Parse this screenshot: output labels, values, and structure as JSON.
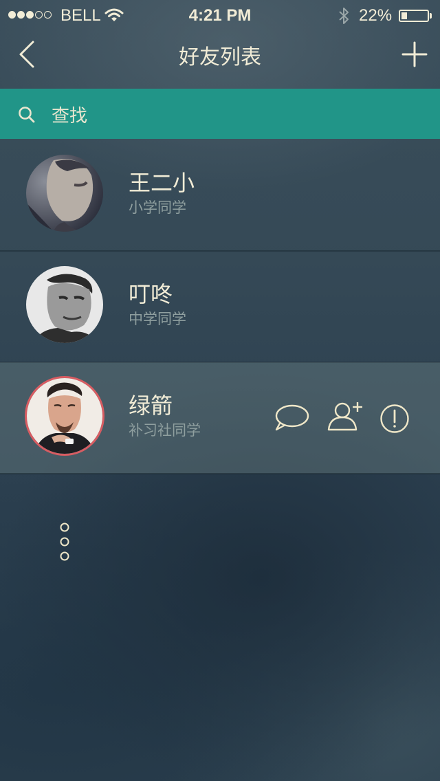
{
  "status_bar": {
    "carrier": "BELL",
    "time": "4:21 PM",
    "battery_percent_text": "22%",
    "battery_level": 0.22,
    "signal_strength": 3,
    "signal_max": 5,
    "icons": [
      "signal-dots-icon",
      "wifi-icon",
      "bluetooth-icon",
      "battery-icon"
    ]
  },
  "nav": {
    "title": "好友列表",
    "back_icon": "chevron-left-icon",
    "add_icon": "plus-icon"
  },
  "search": {
    "icon": "search-icon",
    "placeholder": "查找"
  },
  "friends": [
    {
      "name": "王二小",
      "group": "小学同学",
      "selected": false
    },
    {
      "name": "叮咚",
      "group": "中学同学",
      "selected": false
    },
    {
      "name": "绿箭",
      "group": "补习社同学",
      "selected": true
    }
  ],
  "row_actions": [
    "chat-bubble-icon",
    "add-friend-icon",
    "alert-circle-icon"
  ],
  "colors": {
    "search_bar": "#219588",
    "text": "#f1ecd6",
    "subtext": "#8f9f9f",
    "selected_avatar_ring": "#d85c62",
    "selected_row": "#566f72"
  }
}
